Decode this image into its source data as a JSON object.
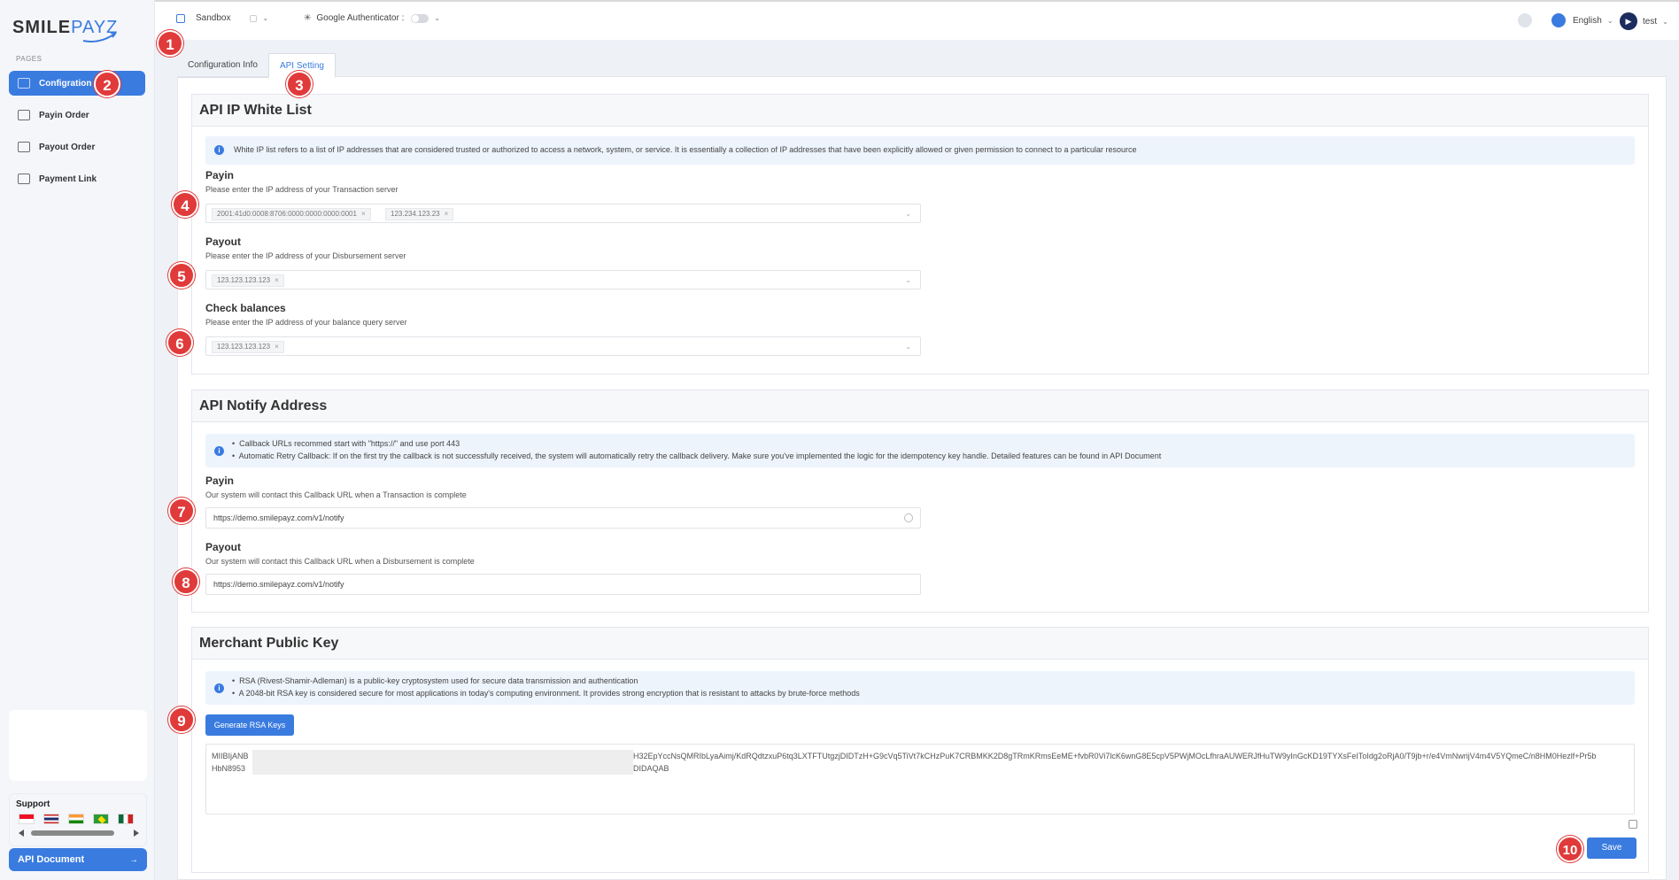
{
  "sidebar": {
    "logo_main": "SMILE",
    "logo_accent": "PAYZ",
    "pages_label": "PAGES",
    "items": [
      {
        "label": "Configration"
      },
      {
        "label": "Payin Order"
      },
      {
        "label": "Payout Order"
      },
      {
        "label": "Payment Link"
      }
    ],
    "support_label": "Support",
    "api_document_label": "API Document"
  },
  "header": {
    "env_label": "Sandbox",
    "ga_label": "Google Authenticator :",
    "language": "English",
    "user": "test"
  },
  "tabs": [
    {
      "label": "Configuration Info"
    },
    {
      "label": "API Setting"
    }
  ],
  "whitelist": {
    "title": "API IP White List",
    "info": "White IP list refers to a list of IP addresses that are considered trusted or authorized to access a network, system, or service. It is essentially a collection of IP addresses that have been explicitly allowed or given permission to connect to a particular resource",
    "payin": {
      "label": "Payin",
      "hint": "Please enter the IP address of your Transaction server",
      "tags": [
        "2001:41d0:0008:8706:0000:0000:0000:0001",
        "123.234.123.23"
      ]
    },
    "payout": {
      "label": "Payout",
      "hint": "Please enter the IP address of your Disbursement server",
      "tags": [
        "123.123.123.123"
      ]
    },
    "check": {
      "label": "Check balances",
      "hint": "Please enter the IP address of your balance query server",
      "tags": [
        "123.123.123.123"
      ]
    }
  },
  "notify": {
    "title": "API Notify Address",
    "bullet1": "Callback URLs recommed start with \"https://\" and use port 443",
    "bullet2": "Automatic Retry Callback: If on the first try the callback is not successfully received, the system will automatically retry the callback delivery. Make sure you've implemented the logic for the idempotency key handle. Detailed features can be found in API Document",
    "payin": {
      "label": "Payin",
      "hint": "Our system will contact this Callback URL when a Transaction is complete",
      "value": "https://demo.smilepayz.com/v1/notify"
    },
    "payout": {
      "label": "Payout",
      "hint": "Our system will contact this Callback URL when a Disbursement is complete",
      "value": "https://demo.smilepayz.com/v1/notify"
    }
  },
  "publickey": {
    "title": "Merchant Public Key",
    "bullet1": "RSA (Rivest-Shamir-Adleman) is a public-key cryptosystem used for secure data transmission and authentication",
    "bullet2": "A 2048-bit RSA key is considered secure for most applications in today's computing environment. It provides strong encryption that is resistant to attacks by brute-force methods",
    "generate_label": "Generate RSA Keys",
    "key_line1_start": "MIIBIjANB",
    "key_line1_end": "H32EpYccNsQMRIbLyaAimj/KdRQdtzxuP6tq3LXTFTUtgzjDIDTzH+G9cVq5TiVt7kCHzPuK7CRBMKK2D8gTRmKRmsEeME+fvbR0Vi7lcK6wnG8E5cpV5PWjMOcLfhraAUWERJfHuTW9yInGcKD19TYXsFeIToIdg2oRjA0/T9jb+r/e4VmNwrijV4m4V5YQmeC/n8HM0Hezlf+Pr5b",
    "key_line2_start": "HbN8953",
    "key_line2_end": "DIDAQAB",
    "save_label": "Save"
  },
  "markers": [
    "1",
    "2",
    "3",
    "4",
    "5",
    "6",
    "7",
    "8",
    "9",
    "10"
  ]
}
